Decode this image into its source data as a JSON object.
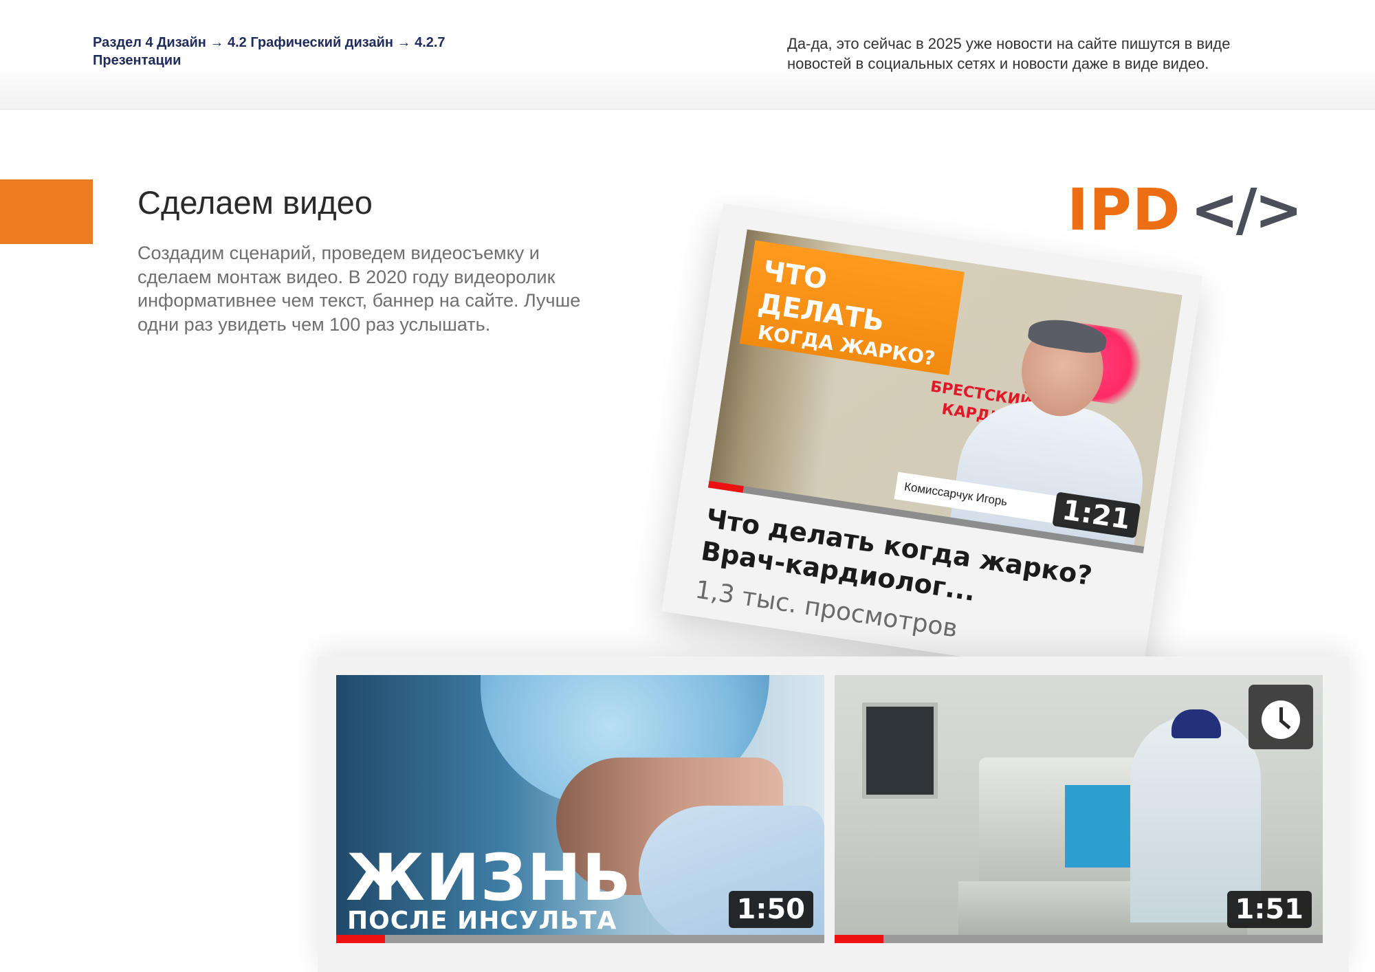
{
  "header": {
    "breadcrumb": "Раздел 4 Дизайн  → 4.2 Графический дизайн → 4.2.7 Презентации",
    "note": "Да-да, это сейчас в 2025 уже новости на сайте пишутся в виде новостей в социальных сетях и новости даже в виде видео."
  },
  "section": {
    "title": "Сделаем видео",
    "description": "Создадим сценарий, проведем видеосъемку и сделаем монтаж видео. В 2020 году видеоролик информативнее чем текст, баннер на сайте. Лучше одни раз увидеть чем 100 раз услышать."
  },
  "logo": {
    "brand": "IPD",
    "code": "</>"
  },
  "featured_video": {
    "banner_line1": "ЧТО ДЕЛАТЬ",
    "banner_line2": "КОГДА ЖАРКО?",
    "sign_text": "БРЕСТСКИЙ КАРДИО",
    "nameplate": "Комиссарчук Игорь",
    "duration": "1:21",
    "title": "Что делать когда жарко? Врач-кардиолог...",
    "views": "1,3 тыс. просмотров",
    "progress_fraction": 0.08
  },
  "videos": [
    {
      "title_big": "ЖИЗНЬ",
      "title_small": "ПОСЛЕ ИНСУЛЬТА",
      "duration": "1:50",
      "progress_fraction": 0.1
    },
    {
      "duration": "1:51",
      "watch_later_icon": "clock-icon",
      "progress_fraction": 0.1
    }
  ],
  "colors": {
    "accent": "#ec7b22",
    "progress": "#ee1111",
    "breadcrumb": "#1f2b5c"
  }
}
